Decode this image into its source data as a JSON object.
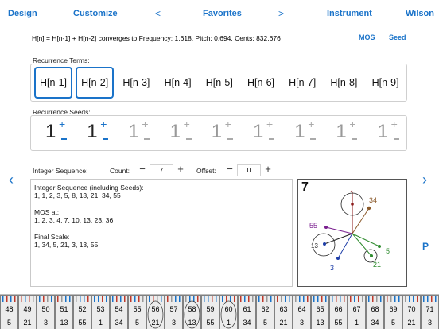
{
  "nav": {
    "design": "Design",
    "customize": "Customize",
    "prev": "<",
    "favorites": "Favorites",
    "next": ">",
    "instrument": "Instrument",
    "wilson": "Wilson"
  },
  "formula": "H[n] = H[n-1] + H[n-2] converges to Frequency: 1.618, Pitch: 0.694, Cents: 832.676",
  "links": {
    "mos": "MOS",
    "seed": "Seed"
  },
  "terms": {
    "label": "Recurrence Terms:",
    "items": [
      "H[n-1]",
      "H[n-2]",
      "H[n-3]",
      "H[n-4]",
      "H[n-5]",
      "H[n-6]",
      "H[n-7]",
      "H[n-8]",
      "H[n-9]"
    ],
    "selected": [
      0,
      1
    ]
  },
  "seeds": {
    "label": "Recurrence Seeds:",
    "values": [
      "1",
      "1",
      "1",
      "1",
      "1",
      "1",
      "1",
      "1",
      "1"
    ],
    "active": [
      0,
      1
    ]
  },
  "controls": {
    "integer_sequence": "Integer Sequence:",
    "count_label": "Count:",
    "count_value": "7",
    "offset_label": "Offset:",
    "offset_value": "0",
    "minus": "−",
    "plus": "+"
  },
  "sequence_text": {
    "line1": "Integer Sequence (including Seeds):",
    "line2": "1, 1, 2, 3, 5, 8, 13, 21, 34, 55",
    "line3": "",
    "line4": "MOS at:",
    "line5": "1, 2, 3, 4, 7, 10, 13, 23, 36",
    "line6": "",
    "line7": "Final Scale:",
    "line8": "1, 34, 5, 21, 3, 13, 55"
  },
  "graph": {
    "title": "7",
    "labels": [
      "1",
      "34",
      "55",
      "13",
      "5",
      "21",
      "3"
    ],
    "colors": {
      "c1": "#8b1a1a",
      "c34": "#8b5a2b",
      "c55": "#7a1f8f",
      "c13": "#222222",
      "c5": "#2e8b2e",
      "c21": "#2e8b2e",
      "c3": "#1f3fa8"
    }
  },
  "side": {
    "left_arrow": "‹",
    "right_arrow": "›",
    "p": "P"
  },
  "keyboard": {
    "top": [
      "48",
      "49",
      "50",
      "51",
      "52",
      "53",
      "54",
      "55",
      "56",
      "57",
      "58",
      "59",
      "60",
      "61",
      "62",
      "63",
      "64",
      "65",
      "66",
      "67",
      "68",
      "69",
      "70",
      "71"
    ],
    "bottom": [
      "5",
      "21",
      "3",
      "13",
      "55",
      "1",
      "34",
      "5",
      "21",
      "3",
      "13",
      "55",
      "1",
      "34",
      "5",
      "21",
      "3",
      "13",
      "55",
      "1",
      "34",
      "5",
      "21",
      "3"
    ],
    "circled": [
      "56",
      "58",
      "60"
    ],
    "accent": "#1a73c9"
  }
}
